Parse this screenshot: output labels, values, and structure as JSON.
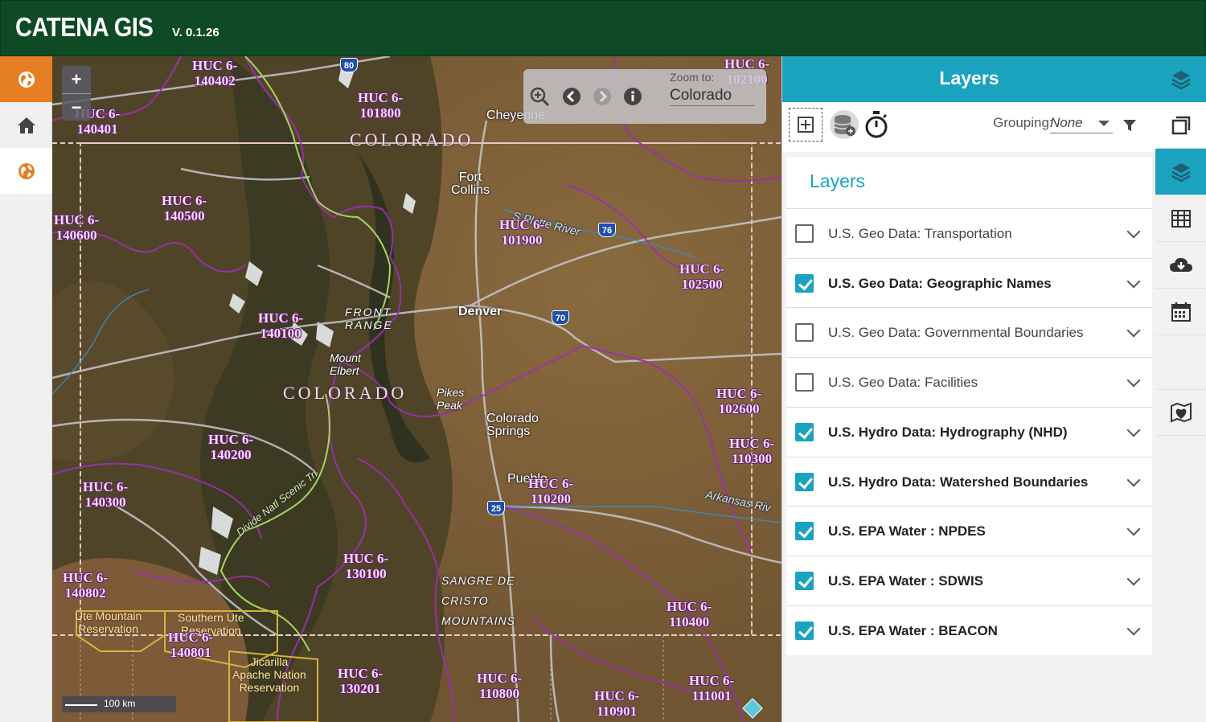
{
  "app": {
    "title": "CATENA GIS",
    "version": "V. 0.1.26"
  },
  "left_rail": {
    "icons": [
      "globe-icon",
      "home-icon",
      "globe-icon"
    ]
  },
  "map": {
    "zoom": {
      "plus": "+",
      "minus": "−"
    },
    "toolbar": {
      "zoom_to_label": "Zoom to:",
      "zoom_to_value": "Colorado"
    },
    "scale": "100 km",
    "huc_labels": [
      {
        "text": "HUC 6-\n140402"
      },
      {
        "text": "HUC 6-\n140401"
      },
      {
        "text": "HUC 6-\n101800"
      },
      {
        "text": "HUC 6-\n102100"
      },
      {
        "text": "HUC 6-\n140500"
      },
      {
        "text": "HUC 6-\n140600"
      },
      {
        "text": "HUC 6-\n101900"
      },
      {
        "text": "HUC 6-\n102500"
      },
      {
        "text": "HUC 6-\n140100"
      },
      {
        "text": "HUC 6-\n102600"
      },
      {
        "text": "HUC 6-\n110300"
      },
      {
        "text": "HUC 6-\n140200"
      },
      {
        "text": "HUC 6-\n140300"
      },
      {
        "text": "HUC 6-\n110200"
      },
      {
        "text": "HUC 6-\n130100"
      },
      {
        "text": "HUC 6-\n140802"
      },
      {
        "text": "HUC 6-\n110400"
      },
      {
        "text": "HUC 6-\n140801"
      },
      {
        "text": "HUC 6-\n130201"
      },
      {
        "text": "HUC 6-\n110800"
      },
      {
        "text": "HUC 6-\n110901"
      },
      {
        "text": "HUC 6-\n111001"
      }
    ],
    "places": {
      "cheyenne": "Cheyenne",
      "fort_collins": "Fort\nCollins",
      "denver": "Denver",
      "colorado_springs": "Colorado\nSprings",
      "pueblo": "Pueblo",
      "pikes_peak": "Pikes\nPeak",
      "mount_elbert": "Mount\nElbert",
      "front_range": "FRONT\nRANGE",
      "sangre": "SANGRE DE\nCRISTO\nMOUNTAINS",
      "state_top": "COLORADO",
      "state_mid": "COLORADO",
      "ute_mountain": "Ute Mountain\nReservation",
      "southern_ute": "Southern Ute\nReservation",
      "jicarilla": "Jicarilla\nApache Nation\nReservation",
      "south_platte": "S Platte River",
      "arkansas": "Arkansas Riv",
      "divide_trail": "Divide Natl Scenic Trl"
    },
    "shields": [
      "80",
      "76",
      "70",
      "25"
    ]
  },
  "panel": {
    "title": "Layers",
    "grouping_label": "Grouping:",
    "grouping_value": "None",
    "heading": "Layers",
    "layers": [
      {
        "label": "U.S. Geo Data: Transportation",
        "checked": false
      },
      {
        "label": "U.S. Geo Data: Geographic Names",
        "checked": true
      },
      {
        "label": "U.S. Geo Data: Governmental Boundaries",
        "checked": false
      },
      {
        "label": "U.S. Geo Data: Facilities",
        "checked": false
      },
      {
        "label": "U.S. Hydro Data: Hydrography (NHD)",
        "checked": true
      },
      {
        "label": "U.S. Hydro Data: Watershed Boundaries",
        "checked": true
      },
      {
        "label": "U.S. EPA Water : NPDES",
        "checked": true
      },
      {
        "label": "U.S. EPA Water : SDWIS",
        "checked": true
      },
      {
        "label": "U.S. EPA Water : BEACON",
        "checked": true
      }
    ]
  },
  "right_rail": {
    "icons": [
      "layers-icon",
      "window-icon",
      "layers-icon",
      "table-icon",
      "cloud-download-icon",
      "calendar-icon",
      "map-heart-icon"
    ]
  },
  "colors": {
    "header_green": "#0e4a25",
    "accent_teal": "#1aa3bf",
    "accent_orange": "#e67e22",
    "huc_purple": "#9b2fae"
  }
}
